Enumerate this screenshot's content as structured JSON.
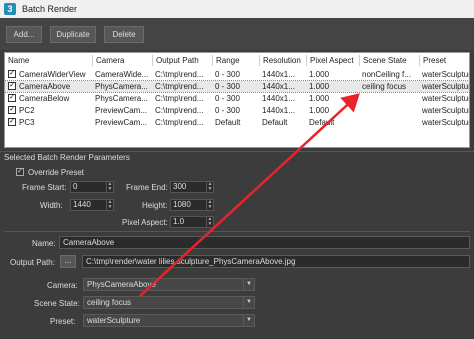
{
  "window": {
    "title": "Batch Render",
    "app_icon_glyph": "3"
  },
  "toolbar": {
    "add_label": "Add...",
    "duplicate_label": "Duplicate",
    "delete_label": "Delete"
  },
  "table": {
    "headers": [
      "Name",
      "Camera",
      "Output Path",
      "Range",
      "Resolution",
      "Pixel Aspect",
      "Scene State",
      "Preset"
    ],
    "rows": [
      {
        "checked": "✓",
        "name": "CameraWiderView",
        "camera": "CameraWide...",
        "output": "C:\\tmp\\rend...",
        "range": "0 - 300",
        "resolution": "1440x1...",
        "aspect": "1.000",
        "state": "nonCeiling f...",
        "preset": "waterSculpture"
      },
      {
        "checked": "✓",
        "name": "CameraAbove",
        "camera": "PhysCamera...",
        "output": "C:\\tmp\\rend...",
        "range": "0 - 300",
        "resolution": "1440x1...",
        "aspect": "1.000",
        "state": "ceiling focus",
        "preset": "waterSculpture"
      },
      {
        "checked": "✓",
        "name": "CameraBelow",
        "camera": "PhysCamera...",
        "output": "C:\\tmp\\rend...",
        "range": "0 - 300",
        "resolution": "1440x1...",
        "aspect": "1.000",
        "state": "",
        "preset": "waterSculpture"
      },
      {
        "checked": "✓",
        "name": "PC2",
        "camera": "PreviewCam...",
        "output": "C:\\tmp\\rend...",
        "range": "0 - 300",
        "resolution": "1440x1...",
        "aspect": "1.000",
        "state": "",
        "preset": "waterSculpture"
      },
      {
        "checked": "✓",
        "name": "PC3",
        "camera": "PreviewCam...",
        "output": "C:\\tmp\\rend...",
        "range": "Default",
        "resolution": "Default",
        "aspect": "Default",
        "state": "",
        "preset": "waterSculpture"
      }
    ]
  },
  "params": {
    "section_title": "Selected Batch Render Parameters",
    "override_checked": "✓",
    "override_label": "Override Preset",
    "frame_start_label": "Frame Start:",
    "frame_start": "0",
    "frame_end_label": "Frame End:",
    "frame_end": "300",
    "width_label": "Width:",
    "width": "1440",
    "height_label": "Height:",
    "height": "1080",
    "pixel_aspect_label": "Pixel Aspect:",
    "pixel_aspect": "1.0",
    "name_label": "Name:",
    "name": "CameraAbove",
    "output_path_label": "Output Path:",
    "browse_label": "...",
    "output_path": "C:\\tmp\\render\\water lilies sculpture_PhysCameraAbove.jpg",
    "camera_label": "Camera:",
    "camera": "PhysCameraAbove",
    "scene_state_label": "Scene State:",
    "scene_state": "ceiling focus",
    "preset_label": "Preset:",
    "preset": "waterSculpture"
  },
  "annotation": {
    "arrow_color": "#e8232a"
  },
  "icons": [
    "app-icon",
    "checkbox-icon",
    "dropdown-arrow-icon",
    "spinner-arrows-icon"
  ]
}
